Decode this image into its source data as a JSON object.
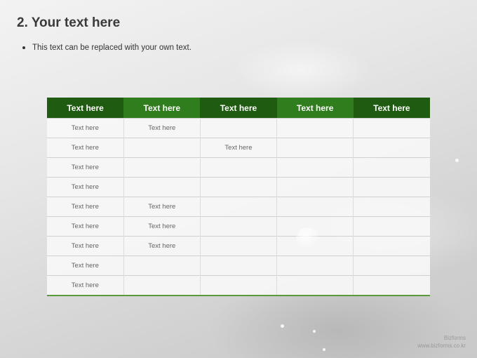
{
  "slide": {
    "title": "2. Your text here",
    "bullet": "This text can be replaced with your own text."
  },
  "table": {
    "headers": [
      "Text here",
      "Text here",
      "Text here",
      "Text here",
      "Text here"
    ],
    "rows": [
      [
        "Text here",
        "Text here",
        "",
        "",
        ""
      ],
      [
        "Text here",
        "",
        "Text here",
        "",
        ""
      ],
      [
        "Text here",
        "",
        "",
        "",
        ""
      ],
      [
        "Text here",
        "",
        "",
        "",
        ""
      ],
      [
        "Text here",
        "Text here",
        "",
        "",
        ""
      ],
      [
        "Text here",
        "Text here",
        "",
        "",
        ""
      ],
      [
        "Text here",
        "Text here",
        "",
        "",
        ""
      ],
      [
        "Text here",
        "",
        "",
        "",
        ""
      ],
      [
        "Text here",
        "",
        "",
        "",
        ""
      ]
    ]
  },
  "footer": {
    "brand": "Bizforms",
    "url": "www.bizforms.co.kr"
  },
  "colors": {
    "header_dark": "#1f5c12",
    "header_light": "#2f7d1d",
    "accent_line": "#5a9a3a"
  }
}
